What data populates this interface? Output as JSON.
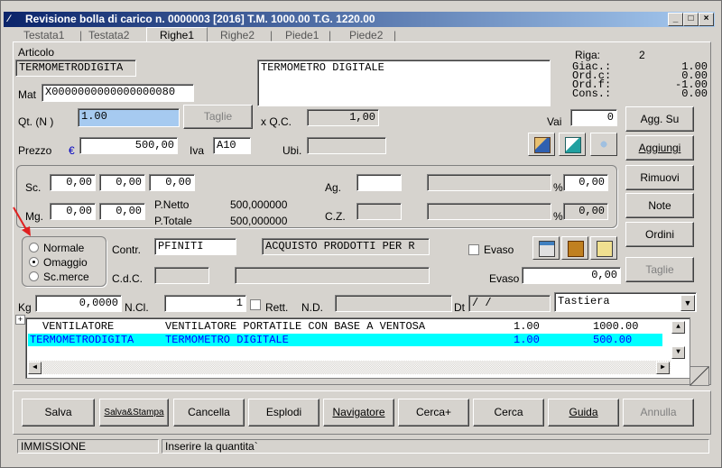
{
  "window": {
    "title": "Revisione bolla di carico n. 0000003 [2016]  T.M.     1000.00  T.G.      1220.00"
  },
  "tabs": [
    {
      "label": "Testata1"
    },
    {
      "label": "Testata2"
    },
    {
      "label": "Righe1"
    },
    {
      "label": "Righe2"
    },
    {
      "label": "Piede1"
    },
    {
      "label": "Piede2"
    }
  ],
  "articolo": {
    "label": "Articolo",
    "code": "TERMOMETRODIGITA",
    "description": "TERMOMETRO DIGITALE"
  },
  "riga": {
    "label": "Riga:",
    "value": "2"
  },
  "giacenze": {
    "labels": [
      "Giac.:",
      "Ord.c:",
      "Ord.f:",
      "Cons.:"
    ],
    "values": [
      "1.00",
      "0.00",
      "-1.00",
      "0.00"
    ]
  },
  "mat": {
    "label": "Mat",
    "value": "X0000000000000000080"
  },
  "qt": {
    "label": "Qt. (N )",
    "value": "1.00",
    "taglie_label": "Taglie",
    "qc_label": "x  Q.C.",
    "qc_value": "1,00"
  },
  "vai": {
    "label": "Vai",
    "value": "0"
  },
  "prezzo": {
    "label": "Prezzo",
    "currency": "€",
    "value": "500,00",
    "iva_label": "Iva",
    "iva_value": "A10",
    "ubi_label": "Ubi."
  },
  "sconti": {
    "sc_label": "Sc.",
    "sc_values": [
      "0,00",
      "0,00",
      "0,00"
    ],
    "mg_label": "Mg.",
    "mg_values": [
      "0,00",
      "0,00"
    ],
    "pnetto_label": "P.Netto",
    "pnetto_value": "500,000000",
    "ptotale_label": "P.Totale",
    "ptotale_value": "500,000000",
    "ag_label": "Ag.",
    "cz_label": "C.Z.",
    "pct": "%",
    "ag_pct": "0,00",
    "cz_pct": "0,00"
  },
  "tipo": {
    "options": [
      "Normale",
      "Omaggio",
      "Sc.merce"
    ],
    "selected": "Omaggio"
  },
  "contr": {
    "label": "Contr.",
    "code": "PFINITI",
    "description": "ACQUISTO PRODOTTI PER R",
    "cdc_label": "C.d.C."
  },
  "evaso": {
    "check_label": "Evaso",
    "field_label": "Evaso",
    "value": "0,00"
  },
  "kg": {
    "label": "Kg",
    "value": "0,0000",
    "ncl_label": "N.Cl.",
    "ncl_value": "1",
    "rett_label": "Rett.",
    "nd_label": "N.D.",
    "dt_label": "Dt",
    "dt_value": " /  /"
  },
  "tastiera": {
    "value": "Tastiera"
  },
  "side_buttons": {
    "agg_su": "Agg. Su",
    "aggiungi": "Aggiungi",
    "rimuovi": "Rimuovi",
    "note": "Note",
    "ordini": "Ordini",
    "taglie": "Taglie"
  },
  "grid": {
    "rows": [
      {
        "code": "VENTILATORE",
        "desc": "VENTILATORE PORTATILE CON BASE A VENTOSA",
        "qty": "1.00",
        "total": "1000.00"
      },
      {
        "code": "TERMOMETRODIGITA",
        "desc": "TERMOMETRO DIGITALE",
        "qty": "1.00",
        "total": "500.00"
      }
    ]
  },
  "toolbar": {
    "salva": "Salva",
    "salva_stampa": "Salva&Stampa",
    "cancella": "Cancella",
    "esplodi": "Esplodi",
    "navigatore": "Navigatore",
    "cerca_plus": "Cerca+",
    "cerca": "Cerca",
    "guida": "Guida",
    "annulla": "Annulla"
  },
  "status": {
    "mode": "IMMISSIONE",
    "message": "Inserire la quantita`"
  },
  "colors": {
    "title_start": "#0a246a",
    "title_end": "#a6caf0",
    "selected_row": "#00ffff",
    "selected_text": "#0000ff",
    "input_focus": "#a6caf0"
  }
}
